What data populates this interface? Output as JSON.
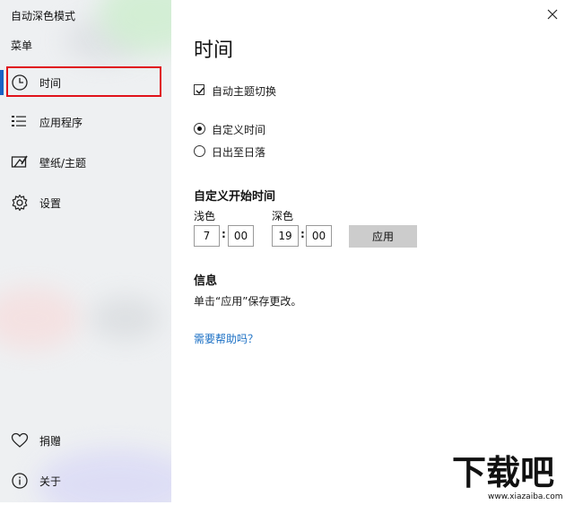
{
  "app": {
    "title": "自动深色模式",
    "menu_label": "菜单"
  },
  "sidebar": {
    "items": [
      {
        "label": "时间",
        "icon": "clock-icon",
        "active": true
      },
      {
        "label": "应用程序",
        "icon": "app-list-icon",
        "active": false
      },
      {
        "label": "壁纸/主题",
        "icon": "wallpaper-icon",
        "active": false
      },
      {
        "label": "设置",
        "icon": "gear-icon",
        "active": false
      }
    ],
    "bottom_items": [
      {
        "label": "捐赠",
        "icon": "heart-icon"
      },
      {
        "label": "关于",
        "icon": "info-icon"
      }
    ]
  },
  "main": {
    "title": "时间",
    "auto_theme_checkbox": {
      "label": "自动主题切换",
      "checked": true
    },
    "time_mode": {
      "options": [
        {
          "label": "自定义时间",
          "selected": true
        },
        {
          "label": "日出至日落",
          "selected": false
        }
      ]
    },
    "custom_start": {
      "title": "自定义开始时间",
      "light": {
        "label": "浅色",
        "hour": "7",
        "minute": "00"
      },
      "dark": {
        "label": "深色",
        "hour": "19",
        "minute": "00"
      },
      "separator": ":",
      "apply_label": "应用"
    },
    "info": {
      "title": "信息",
      "text": "单击“应用”保存更改。"
    },
    "help_link": "需要帮助吗？"
  },
  "window": {
    "close_icon": "close-icon"
  },
  "watermark": {
    "text": "下载吧",
    "url_text": "www.xiazaiba.com"
  },
  "colors": {
    "accent": "#1a62c4",
    "highlight_border": "#e0121a",
    "link": "#1a6fc4",
    "apply_button_bg": "#cccccc",
    "sidebar_bg": "#eef0f2"
  }
}
